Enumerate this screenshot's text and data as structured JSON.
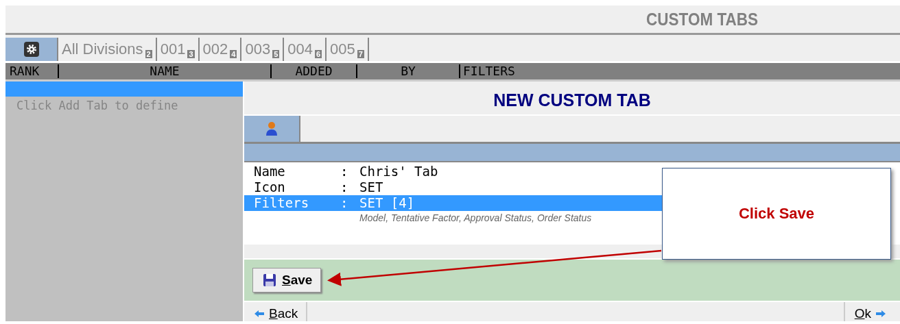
{
  "title": "CUSTOM TABS",
  "tabs": [
    {
      "kind": "icon",
      "selected": true
    },
    {
      "kind": "text",
      "label": "All Divisions",
      "badge": "2",
      "selected": false
    },
    {
      "kind": "text",
      "label": "001",
      "badge": "3",
      "selected": false
    },
    {
      "kind": "text",
      "label": "002",
      "badge": "4",
      "selected": false
    },
    {
      "kind": "text",
      "label": "003",
      "badge": "5",
      "selected": false
    },
    {
      "kind": "text",
      "label": "004",
      "badge": "6",
      "selected": false
    },
    {
      "kind": "text",
      "label": "005",
      "badge": "7",
      "selected": false
    }
  ],
  "columns": [
    "RANK",
    "NAME",
    "ADDED",
    "BY",
    "FILTERS"
  ],
  "list": {
    "hint": "Click Add Tab to define"
  },
  "panel": {
    "title": "NEW CUSTOM TAB",
    "fields": [
      {
        "label": "Name",
        "separator": ":",
        "value": "Chris' Tab",
        "selected": false
      },
      {
        "label": "Icon",
        "separator": ":",
        "value": "SET",
        "selected": false
      },
      {
        "label": "Filters",
        "separator": ":",
        "value": "SET [4]",
        "selected": true,
        "detail": "Model, Tentative Factor, Approval Status, Order Status"
      }
    ],
    "save": {
      "mnemonic": "S",
      "rest": "ave"
    },
    "back": {
      "mnemonic": "B",
      "rest": "ack"
    },
    "ok": {
      "mnemonic": "O",
      "rest": "k"
    }
  },
  "callout": "Click Save"
}
